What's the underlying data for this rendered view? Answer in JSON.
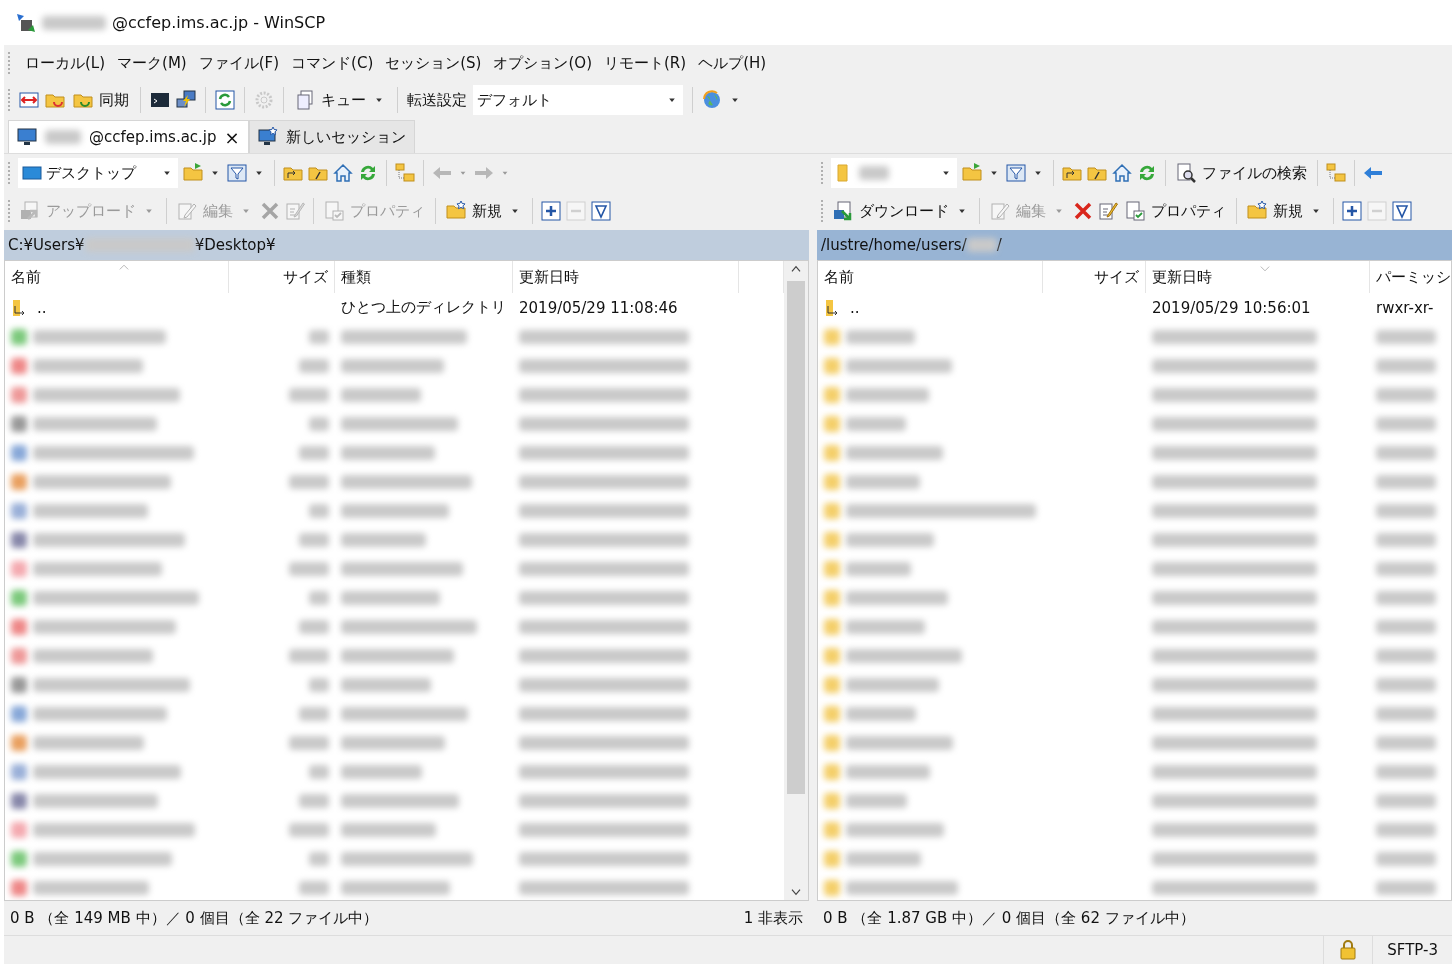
{
  "window": {
    "title": "@ccfep.ims.ac.jp - WinSCP"
  },
  "menu": [
    "ローカル(L)",
    "マーク(M)",
    "ファイル(F)",
    "コマンド(C)",
    "セッション(S)",
    "オプション(O)",
    "リモート(R)",
    "ヘルプ(H)"
  ],
  "toolbar": {
    "sync": "同期",
    "queue": "キュー",
    "transfer_label": "転送設定",
    "transfer_value": "デフォルト"
  },
  "tabs": [
    {
      "label": "@ccfep.ims.ac.jp",
      "selected": true,
      "close": "×"
    },
    {
      "label": "新しいセッション",
      "selected": false
    }
  ],
  "left": {
    "location": "デスクトップ",
    "back_disabled": true,
    "actions": [
      {
        "kind": "upload",
        "label": "アップロード",
        "disabled": true
      },
      {
        "kind": "edit",
        "label": "編集",
        "disabled": true
      },
      {
        "kind": "delete",
        "disabled": true
      },
      {
        "kind": "rename",
        "disabled": true
      },
      {
        "kind": "properties",
        "label": "プロパティ",
        "disabled": true
      },
      {
        "kind": "new",
        "label": "新規",
        "disabled": false
      }
    ],
    "active": false,
    "path_start": "C:¥Users¥",
    "path_end": "¥Desktop¥",
    "columns": [
      {
        "label": "名前",
        "sorted": true
      },
      {
        "label": "サイズ",
        "sorted": false
      },
      {
        "label": "種類",
        "sorted": false
      },
      {
        "label": "更新日時",
        "sorted": false
      }
    ],
    "parent": {
      "name": "..",
      "type": "ひとつ上のディレクトリ",
      "modified": "2019/05/29  11:08:46"
    },
    "rows": [
      {
        "kind": "file"
      },
      {
        "kind": "file"
      },
      {
        "kind": "file"
      },
      {
        "kind": "file"
      },
      {
        "kind": "file"
      },
      {
        "kind": "file"
      },
      {
        "kind": "file"
      },
      {
        "kind": "file"
      },
      {
        "kind": "file"
      },
      {
        "kind": "file"
      },
      {
        "kind": "file"
      },
      {
        "kind": "file"
      },
      {
        "kind": "file"
      },
      {
        "kind": "file"
      },
      {
        "kind": "file"
      },
      {
        "kind": "file"
      },
      {
        "kind": "file"
      },
      {
        "kind": "file"
      },
      {
        "kind": "file"
      },
      {
        "kind": "file"
      }
    ],
    "status": "0 B （全 149 MB 中）／ 0 個目（全 22 ファイル中）",
    "hidden": "1 非表示"
  },
  "right": {
    "back_disabled": false,
    "find": "ファイルの検索",
    "actions": [
      {
        "kind": "download",
        "label": "ダウンロード",
        "disabled": false
      },
      {
        "kind": "edit",
        "label": "編集",
        "disabled": true
      },
      {
        "kind": "delete",
        "disabled": false
      },
      {
        "kind": "rename",
        "disabled": false
      },
      {
        "kind": "properties",
        "label": "プロパティ",
        "disabled": false
      },
      {
        "kind": "new",
        "label": "新規",
        "disabled": false
      }
    ],
    "active": true,
    "path_start": "/lustre/home/users/",
    "path_end": "/",
    "columns": [
      {
        "label": "名前",
        "sorted": false
      },
      {
        "label": "サイズ",
        "sorted": false
      },
      {
        "label": "更新日時",
        "sorted": true
      },
      {
        "label": "パーミッシ",
        "sorted": false
      }
    ],
    "parent": {
      "name": "..",
      "modified": "2019/05/29 10:56:01",
      "permissions": "rwxr-xr-"
    },
    "rows": [
      {
        "kind": "folder"
      },
      {
        "kind": "folder"
      },
      {
        "kind": "folder"
      },
      {
        "kind": "folder"
      },
      {
        "kind": "folder"
      },
      {
        "kind": "folder"
      },
      {
        "kind": "folder"
      },
      {
        "kind": "folder"
      },
      {
        "kind": "folder"
      },
      {
        "kind": "folder"
      },
      {
        "kind": "folder"
      },
      {
        "kind": "folder"
      },
      {
        "kind": "folder"
      },
      {
        "kind": "folder"
      },
      {
        "kind": "folder"
      },
      {
        "kind": "folder"
      },
      {
        "kind": "folder"
      },
      {
        "kind": "folder"
      },
      {
        "kind": "folder"
      },
      {
        "kind": "folder"
      }
    ],
    "status": "0 B （全 1.87 GB 中）／ 0 個目（全 62 ファイル中）"
  },
  "status_bar": {
    "protocol": "SFTP-3"
  }
}
